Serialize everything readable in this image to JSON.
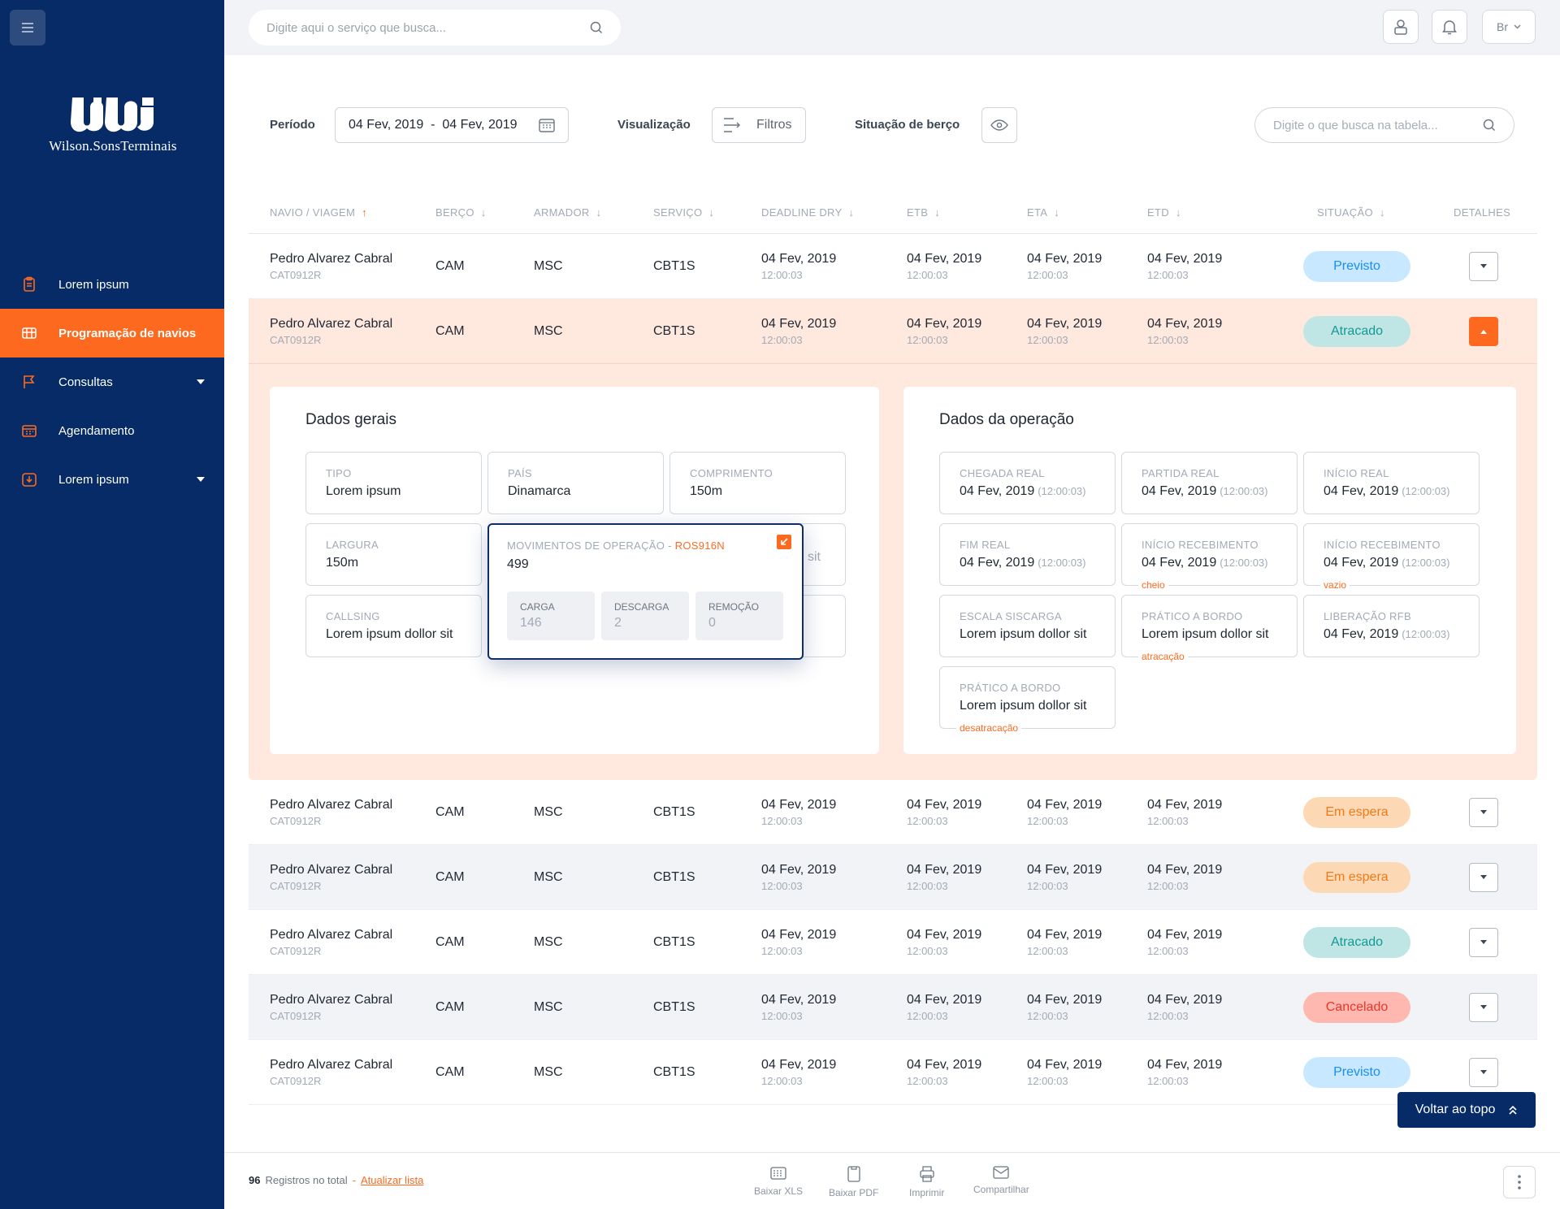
{
  "sidebar": {
    "logo_text": "Wilson.SonsTerminais",
    "items": [
      {
        "label": "Lorem ipsum",
        "icon": "clipboard-icon",
        "active": false,
        "caret": false
      },
      {
        "label": "Programação de navios",
        "icon": "ship-grid-icon",
        "active": true,
        "caret": false
      },
      {
        "label": "Consultas",
        "icon": "flag-icon",
        "active": false,
        "caret": true
      },
      {
        "label": "Agendamento",
        "icon": "calendar-icon",
        "active": false,
        "caret": false
      },
      {
        "label": "Lorem ipsum",
        "icon": "download-box-icon",
        "active": false,
        "caret": true
      }
    ]
  },
  "topbar": {
    "search_placeholder": "Digite aqui o serviço que busca...",
    "language": "Br"
  },
  "filters": {
    "period_label": "Período",
    "period_value": "04 Fev, 2019  -  04 Fev, 2019",
    "view_label": "Visualização",
    "filter_button": "Filtros",
    "berth_label": "Situação de berço",
    "table_search_placeholder": "Digite o que busca na tabela..."
  },
  "table": {
    "columns": [
      {
        "label": "NAVIO / VIAGEM",
        "arrow": "↑"
      },
      {
        "label": "BERÇO",
        "arrow": "↓"
      },
      {
        "label": "ARMADOR",
        "arrow": "↓"
      },
      {
        "label": "SERVIÇO",
        "arrow": "↓"
      },
      {
        "label": "DEADLINE DRY",
        "arrow": "↓"
      },
      {
        "label": "ETB",
        "arrow": "↓"
      },
      {
        "label": "ETA",
        "arrow": "↓"
      },
      {
        "label": "ETD",
        "arrow": "↓"
      },
      {
        "label": "SITUAÇÃO",
        "arrow": "↓"
      },
      {
        "label": "DETALHES",
        "arrow": ""
      }
    ],
    "rows": [
      {
        "ship": "Pedro Alvarez Cabral",
        "voyage": "CAT0912R",
        "berth": "CAM",
        "owner": "MSC",
        "service": "CBT1S",
        "deadline_date": "04 Fev, 2019",
        "deadline_time": "12:00:03",
        "etb_date": "04 Fev, 2019",
        "etb_time": "12:00:03",
        "eta_date": "04 Fev, 2019",
        "eta_time": "12:00:03",
        "etd_date": "04 Fev, 2019",
        "etd_time": "12:00:03",
        "status": "Previsto"
      },
      {
        "ship": "Pedro Alvarez Cabral",
        "voyage": "CAT0912R",
        "berth": "CAM",
        "owner": "MSC",
        "service": "CBT1S",
        "deadline_date": "04 Fev, 2019",
        "deadline_time": "12:00:03",
        "etb_date": "04 Fev, 2019",
        "etb_time": "12:00:03",
        "eta_date": "04 Fev, 2019",
        "eta_time": "12:00:03",
        "etd_date": "04 Fev, 2019",
        "etd_time": "12:00:03",
        "status": "Atracado"
      },
      {
        "ship": "Pedro Alvarez Cabral",
        "voyage": "CAT0912R",
        "berth": "CAM",
        "owner": "MSC",
        "service": "CBT1S",
        "deadline_date": "04 Fev, 2019",
        "deadline_time": "12:00:03",
        "etb_date": "04 Fev, 2019",
        "etb_time": "12:00:03",
        "eta_date": "04 Fev, 2019",
        "eta_time": "12:00:03",
        "etd_date": "04 Fev, 2019",
        "etd_time": "12:00:03",
        "status": "Em espera"
      },
      {
        "ship": "Pedro Alvarez Cabral",
        "voyage": "CAT0912R",
        "berth": "CAM",
        "owner": "MSC",
        "service": "CBT1S",
        "deadline_date": "04 Fev, 2019",
        "deadline_time": "12:00:03",
        "etb_date": "04 Fev, 2019",
        "etb_time": "12:00:03",
        "eta_date": "04 Fev, 2019",
        "eta_time": "12:00:03",
        "etd_date": "04 Fev, 2019",
        "etd_time": "12:00:03",
        "status": "Em espera"
      },
      {
        "ship": "Pedro Alvarez Cabral",
        "voyage": "CAT0912R",
        "berth": "CAM",
        "owner": "MSC",
        "service": "CBT1S",
        "deadline_date": "04 Fev, 2019",
        "deadline_time": "12:00:03",
        "etb_date": "04 Fev, 2019",
        "etb_time": "12:00:03",
        "eta_date": "04 Fev, 2019",
        "eta_time": "12:00:03",
        "etd_date": "04 Fev, 2019",
        "etd_time": "12:00:03",
        "status": "Atracado"
      },
      {
        "ship": "Pedro Alvarez Cabral",
        "voyage": "CAT0912R",
        "berth": "CAM",
        "owner": "MSC",
        "service": "CBT1S",
        "deadline_date": "04 Fev, 2019",
        "deadline_time": "12:00:03",
        "etb_date": "04 Fev, 2019",
        "etb_time": "12:00:03",
        "eta_date": "04 Fev, 2019",
        "eta_time": "12:00:03",
        "etd_date": "04 Fev, 2019",
        "etd_time": "12:00:03",
        "status": "Cancelado"
      },
      {
        "ship": "Pedro Alvarez Cabral",
        "voyage": "CAT0912R",
        "berth": "CAM",
        "owner": "MSC",
        "service": "CBT1S",
        "deadline_date": "04 Fev, 2019",
        "deadline_time": "12:00:03",
        "etb_date": "04 Fev, 2019",
        "etb_time": "12:00:03",
        "eta_date": "04 Fev, 2019",
        "eta_time": "12:00:03",
        "etd_date": "04 Fev, 2019",
        "etd_time": "12:00:03",
        "status": "Previsto"
      }
    ]
  },
  "details": {
    "general": {
      "title": "Dados gerais",
      "fields": [
        {
          "label": "TIPO",
          "value": "Lorem ipsum"
        },
        {
          "label": "PAÍS",
          "value": "Dinamarca"
        },
        {
          "label": "COMPRIMENTO",
          "value": "150m"
        },
        {
          "label": "LARGURA",
          "value": "150m"
        },
        {
          "label": "CALLSING",
          "value": "Lorem ipsum dollor sit"
        }
      ],
      "hidden_value_tail": "sit"
    },
    "popup": {
      "label": "MOVIMENTOS DE OPERAÇÃO - ",
      "code": "ROS916N",
      "value": "499",
      "items": [
        {
          "label": "CARGA",
          "value": "146"
        },
        {
          "label": "DESCARGA",
          "value": "2"
        },
        {
          "label": "REMOÇÃO",
          "value": "0"
        }
      ]
    },
    "operation": {
      "title": "Dados da operação",
      "fields": [
        {
          "label": "CHEGADA REAL",
          "value": "04 Fev, 2019",
          "time": "(12:00:03)",
          "note": ""
        },
        {
          "label": "PARTIDA REAL",
          "value": "04 Fev, 2019",
          "time": "(12:00:03)",
          "note": ""
        },
        {
          "label": "INÍCIO REAL",
          "value": "04 Fev, 2019",
          "time": "(12:00:03)",
          "note": ""
        },
        {
          "label": "FIM REAL",
          "value": "04 Fev, 2019",
          "time": "(12:00:03)",
          "note": ""
        },
        {
          "label": "INÍCIO RECEBIMENTO",
          "value": "04 Fev, 2019",
          "time": "(12:00:03)",
          "note": "cheio"
        },
        {
          "label": "INÍCIO RECEBIMENTO",
          "value": "04 Fev, 2019",
          "time": "(12:00:03)",
          "note": "vazio"
        },
        {
          "label": "ESCALA SISCARGA",
          "value": "Lorem ipsum dollor sit",
          "time": "",
          "note": ""
        },
        {
          "label": "PRÁTICO A BORDO",
          "value": "Lorem ipsum dollor sit",
          "time": "",
          "note": "atracação"
        },
        {
          "label": "LIBERAÇÃO RFB",
          "value": "04 Fev, 2019",
          "time": "(12:00:03)",
          "note": ""
        },
        {
          "label": "PRÁTICO A BORDO",
          "value": "Lorem ipsum dollor sit",
          "time": "",
          "note": "desatracação"
        }
      ]
    }
  },
  "footer": {
    "count": "96",
    "count_text": "Registros no total",
    "separator": "-",
    "refresh_link": "Atualizar lista",
    "actions": [
      {
        "label": "Baixar XLS",
        "icon": "spreadsheet-icon"
      },
      {
        "label": "Baixar PDF",
        "icon": "document-icon"
      },
      {
        "label": "Imprimir",
        "icon": "printer-icon"
      },
      {
        "label": "Compartilhar",
        "icon": "mail-icon"
      }
    ]
  },
  "back_to_top": "Voltar ao topo",
  "colors": {
    "sidebar": "#062b66",
    "accent": "#fd6a1f",
    "expanded_bg": "#ffe8dd"
  }
}
